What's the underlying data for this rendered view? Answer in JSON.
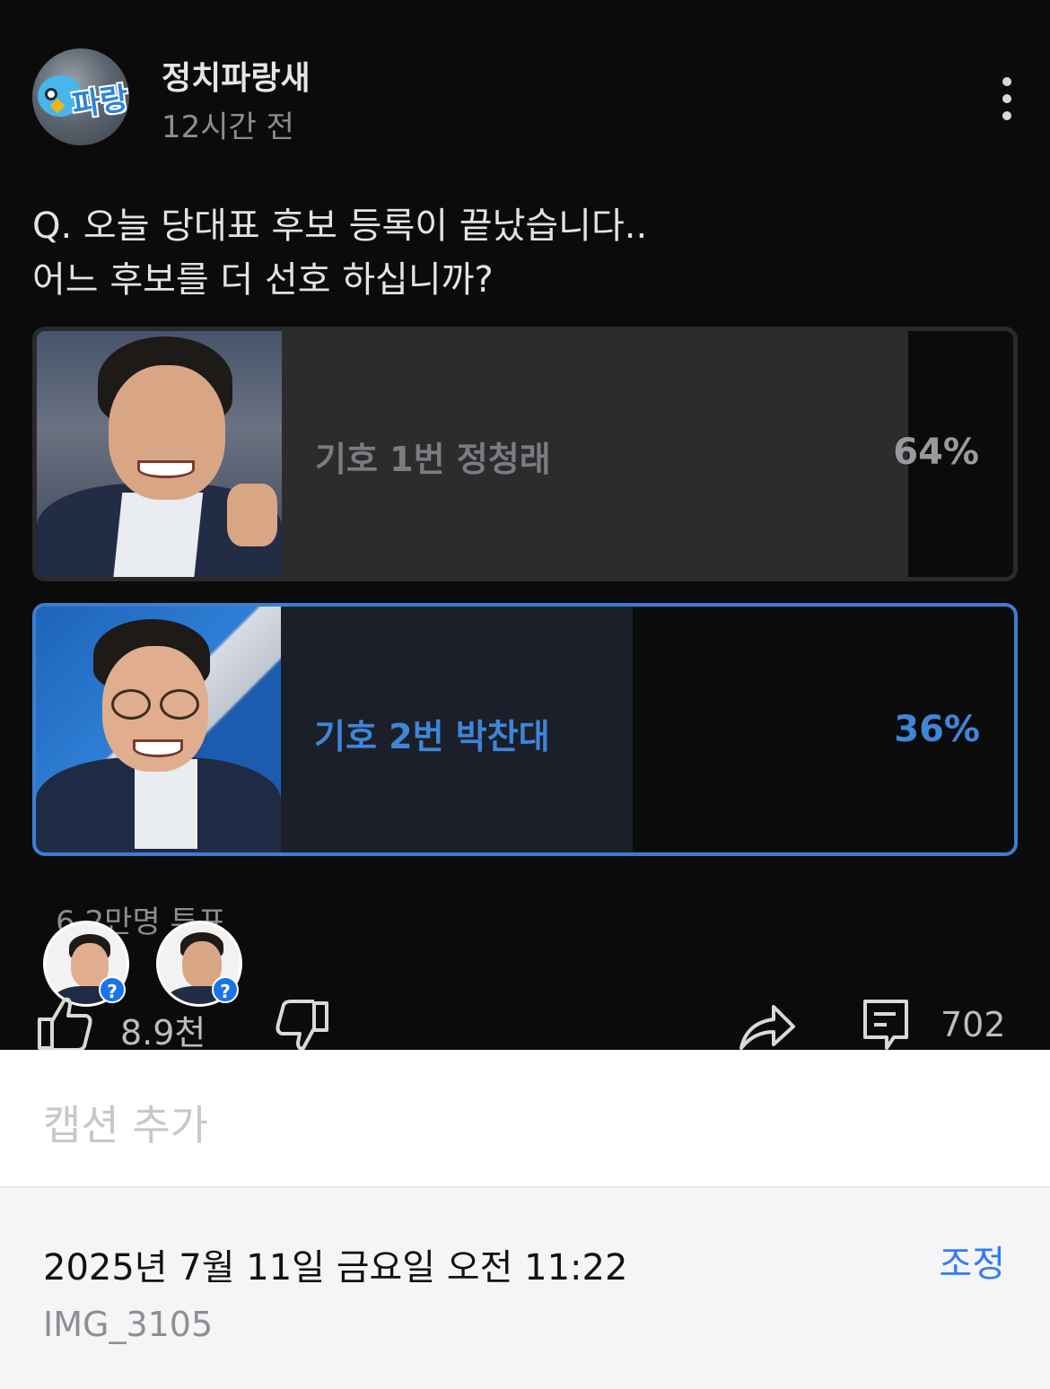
{
  "post": {
    "channel_name": "정치파랑새",
    "time_ago": "12시간 전",
    "avatar_logo_text": "파랑",
    "question_line1": "Q. 오늘 당대표 후보 등록이 끝났습니다..",
    "question_line2": "어느 후보를 더 선호 하십니까?",
    "poll": {
      "options": [
        {
          "label": "기호 1번 정청래",
          "percent_text": "64%",
          "percent": 64,
          "selected": false
        },
        {
          "label": "기호 2번 박찬대",
          "percent_text": "36%",
          "percent": 36,
          "selected": true
        }
      ],
      "votes_text": "6.2만명 투표"
    },
    "actions": {
      "likes": "8.9천",
      "comments": "702"
    },
    "colors": {
      "selected_accent": "#3b7fd0",
      "background": "#0b0b0c"
    }
  },
  "caption": {
    "placeholder": "캡션 추가"
  },
  "photo_info": {
    "datetime": "2025년 7월 11일 금요일 오전 11:22",
    "adjust_label": "조정",
    "filename": "IMG_3105"
  }
}
